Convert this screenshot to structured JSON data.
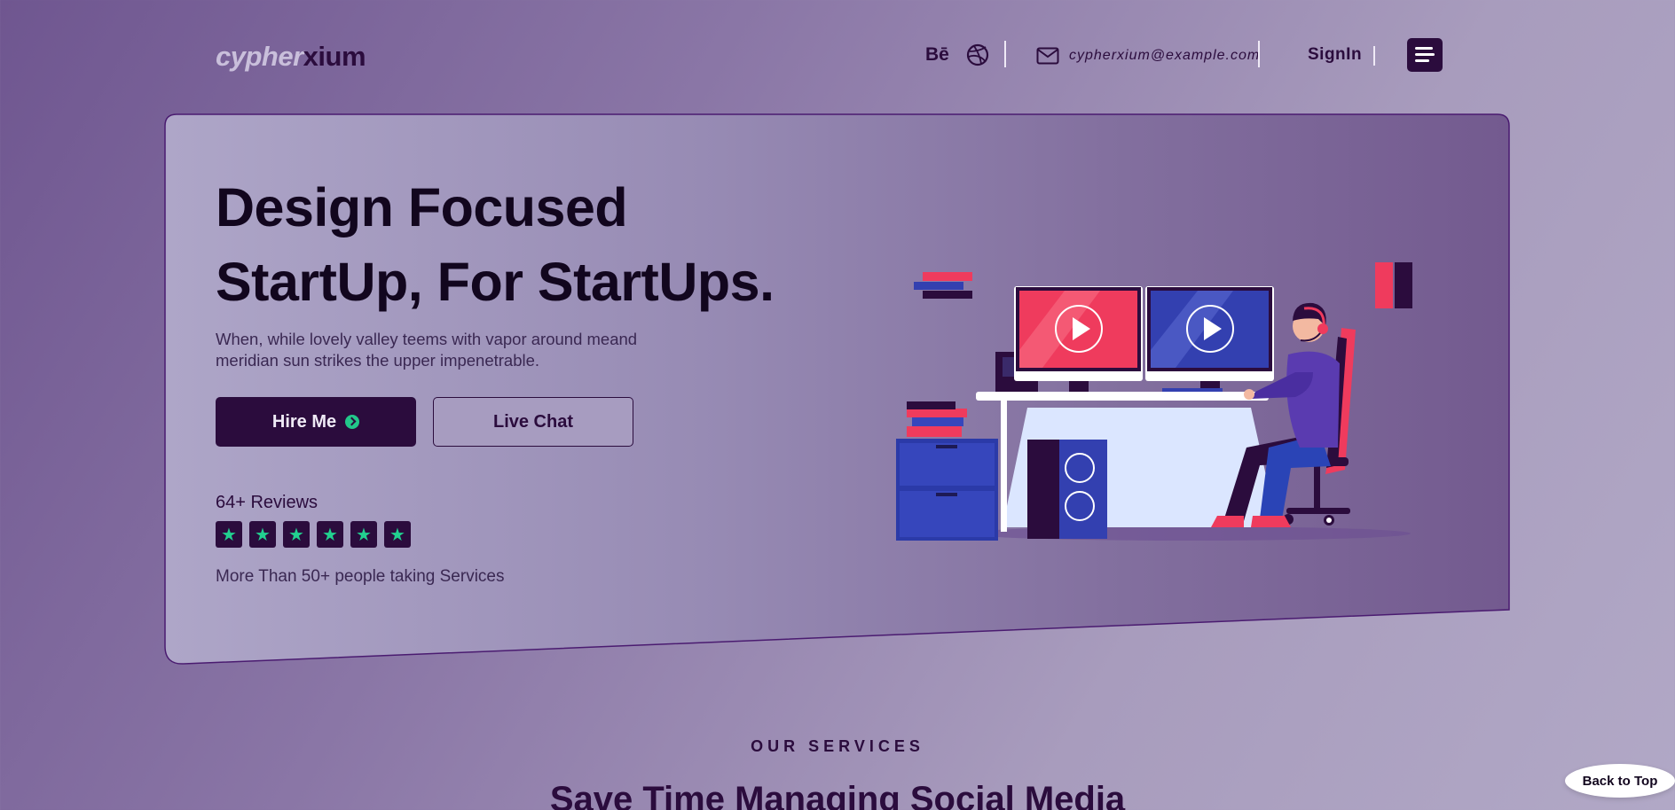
{
  "brand": {
    "logo_part1": "cypher",
    "logo_part2": "xium"
  },
  "header": {
    "behance_label": "Bē",
    "email": "cypherxium@example.com",
    "signin_label": "SignIn"
  },
  "hero": {
    "title_line1": "Design Focused",
    "title_line2": "StartUp, For StartUps.",
    "description": "When, while lovely valley teems with vapor around meand meridian sun strikes the upper impenetrable.",
    "hire_label": "Hire Me",
    "chat_label": "Live Chat",
    "reviews_count": "64+ Reviews",
    "rating_stars": 6,
    "reviews_note": "More Than 50+ people taking Services"
  },
  "services": {
    "kicker": "OUR SERVICES",
    "title": "Save Time Managing Social Media"
  },
  "back_to_top_label": "Back to Top",
  "colors": {
    "primary_dark": "#2b0c3d",
    "accent_green": "#22d08f",
    "accent_red": "#ef3b5d",
    "accent_blue": "#3340b0"
  }
}
